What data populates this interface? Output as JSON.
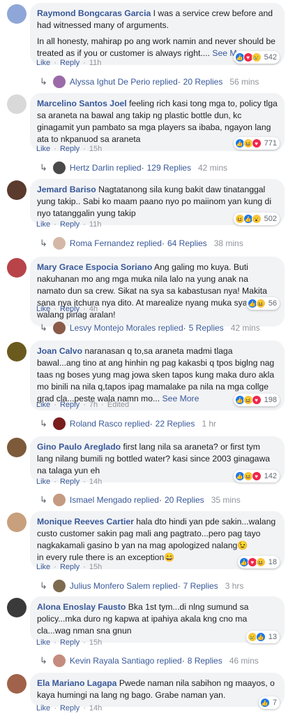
{
  "actions": {
    "like": "Like",
    "reply": "Reply",
    "edited": "Edited"
  },
  "comments": [
    {
      "author": "Raymond Bongcaras Garcia",
      "text": "I was a service crew before and had witnessed many of arguments.",
      "text2": "In all honesty, mahirap po ang work namin and never should be treated as if you or customer is always right....",
      "see_more": "See More",
      "time": "11h",
      "reactions": [
        "like",
        "love",
        "sad"
      ],
      "reaction_count": "542",
      "reply_name": "Alyssa Ighut De Perio replied",
      "reply_count": "20 Replies",
      "reply_time": "56 mins"
    },
    {
      "author": "Marcelino Santos Joel",
      "text": "feeling rich kasi tong mga to, policy tlga sa araneta na bawal ang takip ng plastic bottle dun, kc ginagamit yun pambato sa mga players sa ibaba, ngayon lang ata to nkpanuod sa araneta",
      "time": "15h",
      "reactions": [
        "like",
        "haha",
        "love"
      ],
      "reaction_count": "771",
      "reply_name": "Hertz Darlin replied",
      "reply_count": "129 Replies",
      "reply_time": "42 mins"
    },
    {
      "author": "Jemard Bariso",
      "text": "Nagtatanong sila kung bakit daw tinatanggal yung takip.. Sabi ko maam paano nyo po maiinom yan kung di nyo tatanggalin yung takip",
      "time": "11h",
      "reactions": [
        "haha",
        "like",
        "wow"
      ],
      "reaction_count": "502",
      "reply_name": "Roma Fernandez replied",
      "reply_count": "64 Replies",
      "reply_time": "38 mins"
    },
    {
      "author": "Mary Grace Espocia Soriano",
      "text": "Ang galing mo kuya. Buti nakuhanan mo ang mga muka nila lalo na yung anak na namato dun sa crew. Sikat na sya sa kabastusan nya! Makita sana nya itchura nya dito. At marealize nyang muka syang walang pinag aralan!",
      "time": "4h",
      "reactions": [
        "like",
        "haha"
      ],
      "reaction_count": "56",
      "reply_name": "Lesvy Montejo Morales replied",
      "reply_count": "5 Replies",
      "reply_time": "42 mins"
    },
    {
      "author": "Joan Calvo",
      "text": "naranasan q to,sa araneta madmi tlaga bawal...ang tino at ang hinhin ng pag kakasbi q tpos biglng nag taas ng boses yung mag jowa sken tapos kung maka duro akla mo binili na nila q,tapos ipag mamalake pa nila na mga collge grad cla...peste wala namn mo...",
      "see_more": "See More",
      "time": "7h",
      "edited": true,
      "reactions": [
        "like",
        "haha",
        "love"
      ],
      "reaction_count": "198",
      "reply_name": "Roland Rasco replied",
      "reply_count": "22 Replies",
      "reply_time": "1 hr"
    },
    {
      "author": "Gino Paulo Areglado",
      "text": "first lang nila sa araneta? or first tym lang nilang bumili ng bottled water? kasi since 2003 ginagawa na talaga yun eh",
      "time": "14h",
      "reactions": [
        "like",
        "haha",
        "love"
      ],
      "reaction_count": "142",
      "reply_name": "Ismael Mengado replied",
      "reply_count": "20 Replies",
      "reply_time": "35 mins"
    },
    {
      "author": "Monique Reeves Cartier",
      "text": "hala dto hindi yan pde sakin...walang custo customer sakin pag mali ang pagtrato...pero pag tayo nagkakamali gasino b yan na mag apologized nalang😉",
      "text2": "in every rule there is an exception😄",
      "time": "15h",
      "reactions": [
        "like",
        "love",
        "haha"
      ],
      "reaction_count": "18",
      "reply_name": "Julius Monfero Salem replied",
      "reply_count": "7 Replies",
      "reply_time": "3 hrs"
    },
    {
      "author": "Alona Enoslay Fausto",
      "text": "Bka 1st tym...di nlng sumund sa policy...mka duro ng kapwa at ipahiya akala kng cno ma cla...wag nman sna gnun",
      "time": "15h",
      "reactions": [
        "sad",
        "like"
      ],
      "reaction_count": "13",
      "reply_name": "Kevin Rayala Santiago replied",
      "reply_count": "8 Replies",
      "reply_time": "46 mins"
    },
    {
      "author": "Ela Mariano Lagapa",
      "text": "Pwede naman nila sabihon ng maayos, o kaya humingi na lang ng bago. Grabe naman yan.",
      "time": "14h",
      "reactions": [
        "like"
      ],
      "reaction_count": "7"
    }
  ],
  "colors": {
    "link": "#385898",
    "bubble": "#f2f3f5",
    "muted": "#90949c",
    "like": "#1877f2",
    "love": "#f0284a",
    "emoji": "#f7c844"
  }
}
